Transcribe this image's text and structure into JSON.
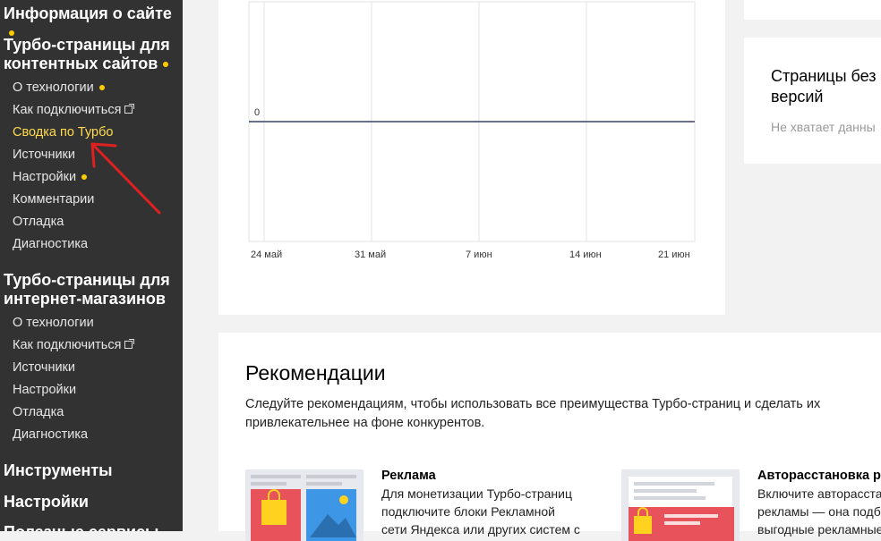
{
  "sidebar": {
    "site_info": "Информация о сайте",
    "turbo_content": "Турбо-страницы для контентных сайтов",
    "content_items": [
      "О технологии",
      "Как подключиться",
      "Сводка по Турбо",
      "Источники",
      "Настройки",
      "Комментарии",
      "Отладка",
      "Диагностика"
    ],
    "turbo_shop": "Турбо-страницы для интернет-магазинов",
    "shop_items": [
      "О технологии",
      "Как подключиться",
      "Источники",
      "Настройки",
      "Отладка",
      "Диагностика"
    ],
    "tools": "Инструменты",
    "settings": "Настройки",
    "useful": "Полезные сервисы"
  },
  "chart_data": {
    "type": "line",
    "x": [
      "24 май",
      "31 май",
      "7 июн",
      "14 июн",
      "21 июн"
    ],
    "series": [
      {
        "values": [
          0,
          0,
          0,
          0,
          0
        ]
      }
    ],
    "ytick": "0"
  },
  "right_card": {
    "title": "Страницы без версий",
    "subtitle": "Не хватает данны"
  },
  "recommendations": {
    "title": "Рекомендации",
    "description": "Следуйте рекомендациям, чтобы использовать все преимущества Турбо-страниц и сделать их привлекательнее на фоне конкурентов.",
    "cards": [
      {
        "title": "Реклама",
        "text": "Для монетизации Турбо-страниц\nподключите блоки Рекламной\nсети Яндекса или других систем с"
      },
      {
        "title": "Авторасстановка ре",
        "text": "Включите авторасста\nрекламы — она подб\nвыгодные рекламные"
      }
    ]
  },
  "colors": {
    "sidebar_bg": "#323232",
    "accent": "#ffcc00",
    "active_link": "#ffdb4d",
    "arrow": "#e02020",
    "chart_line": "#6b6f8f"
  }
}
